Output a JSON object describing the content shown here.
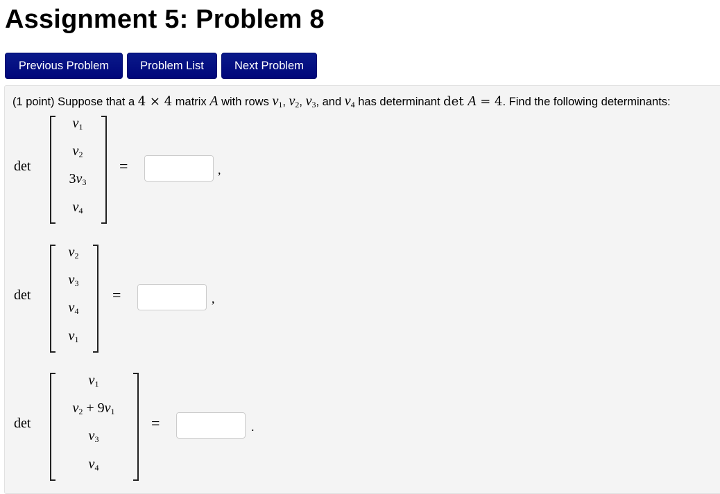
{
  "page_title": "Assignment 5: Problem 8",
  "nav": {
    "previous": "Previous Problem",
    "list": "Problem List",
    "next": "Next Problem"
  },
  "colors": {
    "button_bg": "#00067a",
    "panel_bg": "#f4f4f4"
  },
  "problem": {
    "points": "(1 point)",
    "text_1": " Suppose that a ",
    "dim_a": "4",
    "times": "×",
    "dim_b": "4",
    "text_2": " matrix ",
    "matrix_name": "A",
    "text_3": " with rows ",
    "rows": [
      "v1",
      "v2",
      "v3"
    ],
    "text_4": ", and ",
    "last_row": "v4",
    "text_5": " has determinant ",
    "det_expr": "det A = 4",
    "text_6": ". Find the following determinants:",
    "det_label": "det",
    "equals": "=",
    "parts": [
      {
        "entries": [
          {
            "coef": "",
            "var": "v",
            "sub": "1",
            "extra": ""
          },
          {
            "coef": "",
            "var": "v",
            "sub": "2",
            "extra": ""
          },
          {
            "coef": "3",
            "var": "v",
            "sub": "3",
            "extra": ""
          },
          {
            "coef": "",
            "var": "v",
            "sub": "4",
            "extra": ""
          }
        ],
        "answer": "",
        "punct": ","
      },
      {
        "entries": [
          {
            "coef": "",
            "var": "v",
            "sub": "2",
            "extra": ""
          },
          {
            "coef": "",
            "var": "v",
            "sub": "3",
            "extra": ""
          },
          {
            "coef": "",
            "var": "v",
            "sub": "4",
            "extra": ""
          },
          {
            "coef": "",
            "var": "v",
            "sub": "1",
            "extra": ""
          }
        ],
        "answer": "",
        "punct": ","
      },
      {
        "entries": [
          {
            "coef": "",
            "var": "v",
            "sub": "1",
            "extra": ""
          },
          {
            "coef": "",
            "var": "v",
            "sub": "2",
            "extra": " + 9v1"
          },
          {
            "coef": "",
            "var": "v",
            "sub": "3",
            "extra": ""
          },
          {
            "coef": "",
            "var": "v",
            "sub": "4",
            "extra": ""
          }
        ],
        "answer": "",
        "punct": "."
      }
    ]
  }
}
